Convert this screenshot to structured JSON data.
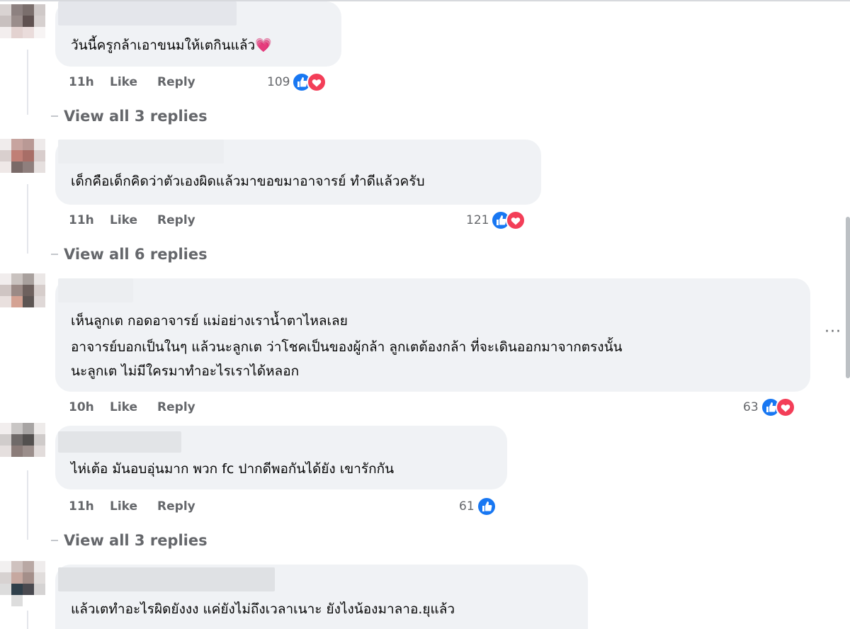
{
  "comments": [
    {
      "lines": [
        "วันนี้ครูกล้าเอาขนมให้เตกินแล้ว💗"
      ],
      "time": "11h",
      "like": "Like",
      "reply": "Reply",
      "count": "109",
      "reactions": [
        "like-icon",
        "love-icon"
      ],
      "view_replies": "View all 3 replies"
    },
    {
      "lines": [
        "เด็กคือเด็กคิดว่าตัวเองผิดแล้วมาขอขมาอาจารย์ ทำดีแล้วครับ"
      ],
      "time": "11h",
      "like": "Like",
      "reply": "Reply",
      "count": "121",
      "reactions": [
        "like-icon",
        "love-icon"
      ],
      "view_replies": "View all 6 replies"
    },
    {
      "lines": [
        "เห็นลูกเต กอดอาจารย์ แม่อย่างเราน้ำตาไหลเลย",
        "อาจารย์บอกเป็นในๆ แล้วนะลูกเต ว่าโชคเป็นของผู้กล้า ลูกเตต้องกล้า ที่จะเดินออกมาจากตรงนั้น",
        "นะลูกเต ไม่มีใครมาทำอะไรเราได้หลอก"
      ],
      "time": "10h",
      "like": "Like",
      "reply": "Reply",
      "count": "63",
      "reactions": [
        "like-icon",
        "love-icon"
      ],
      "more": "···"
    },
    {
      "lines": [
        "ไห่เต้อ มันอบอุ่นมาก พวก fc ปากดีพอกันได้ยัง เขารักกัน"
      ],
      "time": "11h",
      "like": "Like",
      "reply": "Reply",
      "count": "61",
      "reactions": [
        "like-icon"
      ],
      "view_replies": "View all 3 replies"
    },
    {
      "lines": [
        "แล้วเตทำอะไรผิดยังงง แค่ยังไม่ถึงเวลาเนาะ ยังไงน้องมาลาอ.ยุแล้ว"
      ]
    }
  ],
  "colors": {
    "bubble": "#f0f2f5",
    "meta_text": "#65676b",
    "like_blue": "#1877f2",
    "love_red": "#f33e58"
  }
}
